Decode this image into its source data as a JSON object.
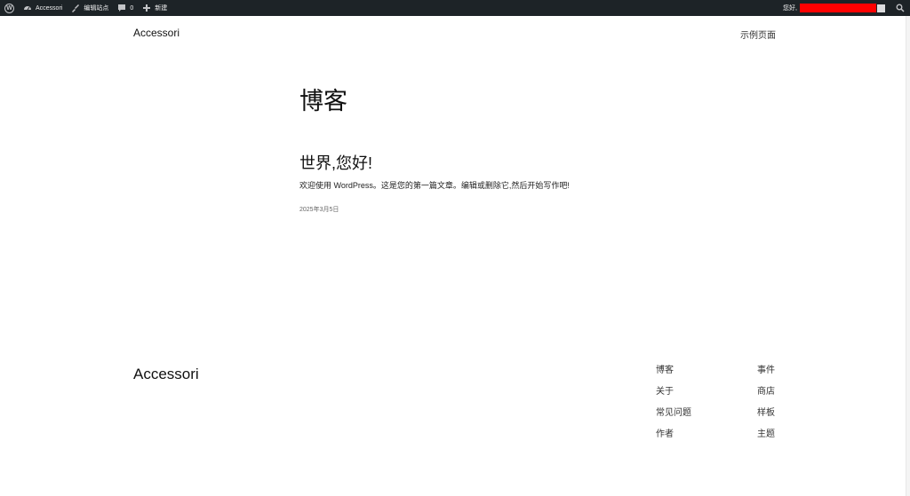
{
  "admin_bar": {
    "site_name": "Accessori",
    "edit_site": "编辑站点",
    "comments_count": "0",
    "new_label": "新建",
    "greeting": "您好,",
    "icons": [
      "wordpress-logo-icon",
      "dashboard-icon",
      "brush-icon",
      "comment-icon",
      "plus-icon",
      "avatar",
      "search-icon"
    ]
  },
  "header": {
    "site_title": "Accessori",
    "nav": [
      "示例页面"
    ]
  },
  "main": {
    "page_title": "博客",
    "post": {
      "title": "世界,您好!",
      "excerpt": "欢迎使用 WordPress。这是您的第一篇文章。编辑或删除它,然后开始写作吧!",
      "date": "2025年3月5日"
    }
  },
  "footer": {
    "site_title": "Accessori",
    "col1": [
      "博客",
      "关于",
      "常见问题",
      "作者"
    ],
    "col2": [
      "事件",
      "商店",
      "样板",
      "主题"
    ]
  },
  "colors": {
    "admin_bar_bg": "#1d2327",
    "redacted": "#ff0000",
    "text": "#111111"
  }
}
